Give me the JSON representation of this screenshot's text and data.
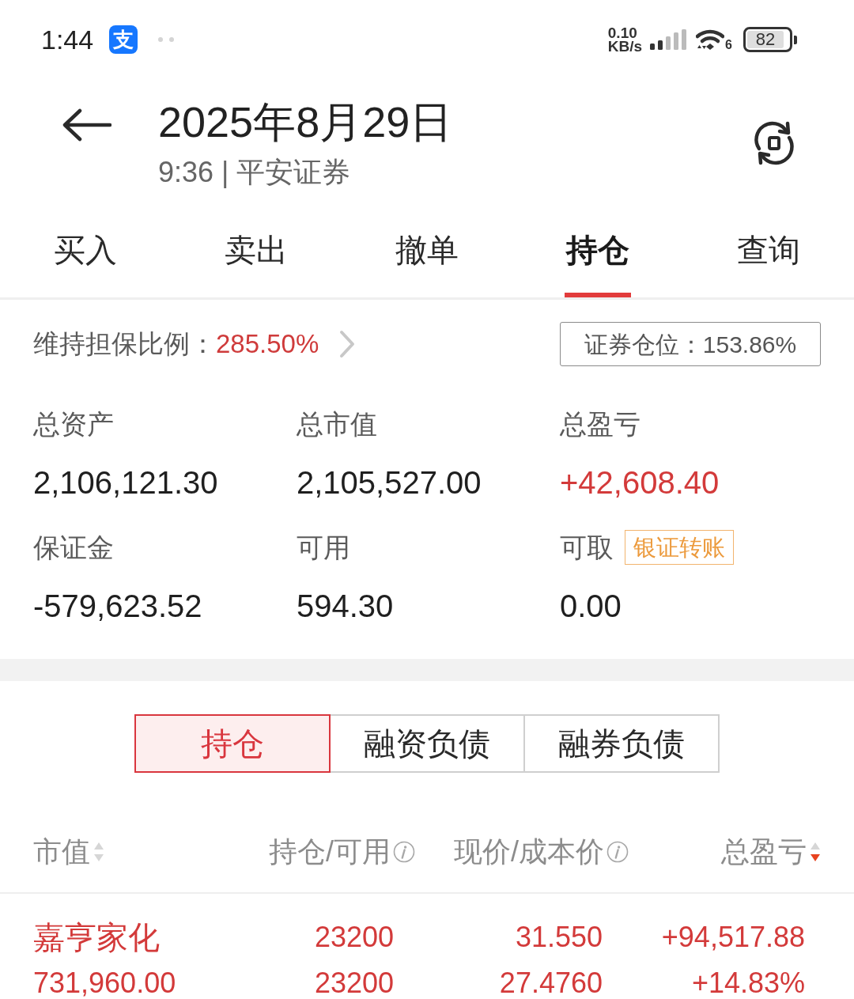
{
  "status_bar": {
    "time": "1:44",
    "app_badge": "支",
    "network_speed": {
      "value": "0.10",
      "unit": "KB/s"
    },
    "wifi_label": "6",
    "battery": "82"
  },
  "header": {
    "title": "2025年8月29日",
    "subtitle": "9:36 | 平安证券"
  },
  "tabs": [
    {
      "label": "买入",
      "selected": false
    },
    {
      "label": "卖出",
      "selected": false
    },
    {
      "label": "撤单",
      "selected": false
    },
    {
      "label": "持仓",
      "selected": true
    },
    {
      "label": "查询",
      "selected": false
    }
  ],
  "margin_ratio": {
    "label": "维持担保比例：",
    "value": "285.50%"
  },
  "position_ratio": "证券仓位：153.86%",
  "summary": [
    {
      "label": "总资产",
      "value": "2,106,121.30",
      "gain": false
    },
    {
      "label": "总市值",
      "value": "2,105,527.00",
      "gain": false
    },
    {
      "label": "总盈亏",
      "value": "+42,608.40",
      "gain": true
    },
    {
      "label": "保证金",
      "value": "-579,623.52",
      "gain": false
    },
    {
      "label": "可用",
      "value": "594.30",
      "gain": false
    },
    {
      "label": "可取",
      "value": "0.00",
      "gain": false,
      "action": "银证转账"
    }
  ],
  "holding_tabs": [
    {
      "label": "持仓",
      "selected": true
    },
    {
      "label": "融资负债",
      "selected": false
    },
    {
      "label": "融券负债",
      "selected": false
    }
  ],
  "table": {
    "columns": [
      {
        "label": "市值",
        "kind": "sort",
        "sorted": false
      },
      {
        "label": "持仓/可用",
        "kind": "info"
      },
      {
        "label": "现价/成本价",
        "kind": "info"
      },
      {
        "label": "总盈亏",
        "kind": "sort",
        "sorted": true
      }
    ],
    "rows": [
      {
        "gain": true,
        "cells": [
          [
            "嘉亨家化",
            "731,960.00"
          ],
          [
            "23200",
            "23200"
          ],
          [
            "31.550",
            "27.4760"
          ],
          [
            "+94,517.88",
            "+14.83%"
          ]
        ]
      }
    ]
  }
}
